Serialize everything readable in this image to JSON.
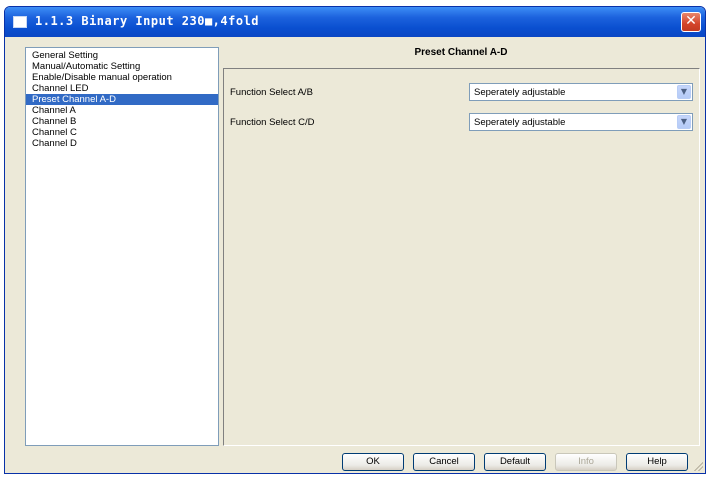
{
  "window": {
    "title": "1.1.3 Binary Input 230■,4fold",
    "close_glyph": "✕"
  },
  "sidebar": {
    "items": [
      {
        "label": "General Setting",
        "selected": false
      },
      {
        "label": "Manual/Automatic Setting",
        "selected": false
      },
      {
        "label": "Enable/Disable manual operation",
        "selected": false
      },
      {
        "label": "Channel LED",
        "selected": false
      },
      {
        "label": "Preset Channel A-D",
        "selected": true
      },
      {
        "label": "Channel A",
        "selected": false
      },
      {
        "label": "Channel B",
        "selected": false
      },
      {
        "label": "Channel C",
        "selected": false
      },
      {
        "label": "Channel D",
        "selected": false
      }
    ]
  },
  "panel": {
    "title": "Preset Channel A-D",
    "params": [
      {
        "label": "Function Select A/B",
        "value": "Seperately adjustable"
      },
      {
        "label": "Function Select C/D",
        "value": "Seperately adjustable"
      }
    ]
  },
  "buttons": {
    "ok": "OK",
    "cancel": "Cancel",
    "default": "Default",
    "info": "Info",
    "help": "Help"
  },
  "icons": {
    "dropdown_arrow": "▼"
  },
  "colors": {
    "titlebar": "#0a4fd0",
    "selection": "#316ac5",
    "dialog_bg": "#ece9d8"
  }
}
